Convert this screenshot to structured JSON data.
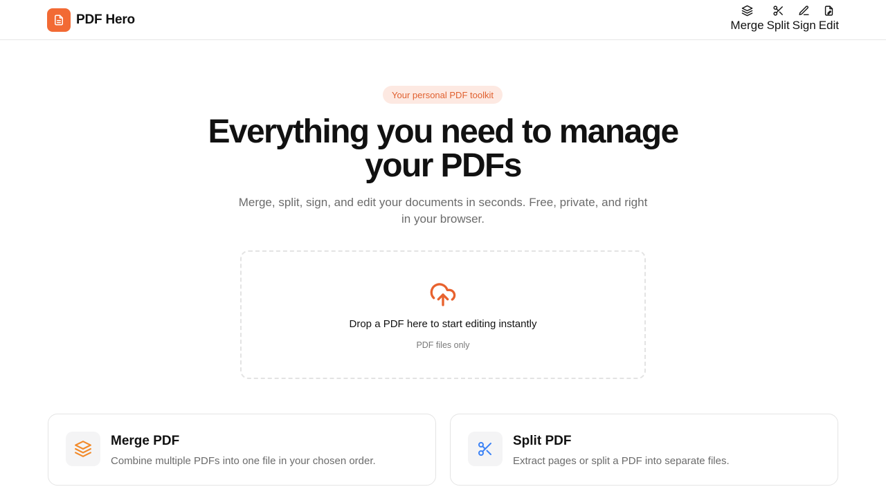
{
  "brand": {
    "name": "PDF Hero",
    "logo_color": "#f26a34"
  },
  "nav": [
    {
      "label": "Merge",
      "icon": "layers-icon"
    },
    {
      "label": "Split",
      "icon": "scissors-icon"
    },
    {
      "label": "Sign",
      "icon": "pen-icon"
    },
    {
      "label": "Edit",
      "icon": "file-edit-icon"
    }
  ],
  "hero": {
    "badge": "Your personal PDF toolkit",
    "title": "Everything you need to manage your PDFs",
    "subtitle": "Merge, split, sign, and edit your documents in seconds. Free, private, and right in your browser."
  },
  "dropzone": {
    "icon": "cloud-upload-icon",
    "title": "Drop a PDF here to start editing instantly",
    "hint": "PDF files only"
  },
  "cards": [
    {
      "title": "Merge PDF",
      "description": "Combine multiple PDFs into one file in your chosen order.",
      "icon": "layers-icon",
      "icon_color": "#f28a2a"
    },
    {
      "title": "Split PDF",
      "description": "Extract pages or split a PDF into separate files.",
      "icon": "scissors-icon",
      "icon_color": "#3b82f6"
    }
  ],
  "colors": {
    "accent": "#f26a34",
    "badge_bg": "#fde9e2",
    "badge_text": "#e0602f"
  }
}
